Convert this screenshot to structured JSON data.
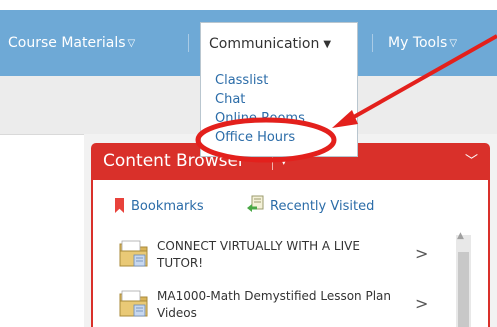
{
  "topnav": {
    "items": [
      {
        "label": "Course Materials",
        "caret": "▽"
      },
      {
        "label": "My Tools",
        "caret": "▽"
      }
    ],
    "active": {
      "label": "Communication",
      "caret": "▼"
    }
  },
  "dropdown": {
    "items": [
      "Classlist",
      "Chat",
      "Online Rooms",
      "Office Hours"
    ]
  },
  "content_browser": {
    "title": "Content Browser",
    "tools": {
      "bookmarks": "Bookmarks",
      "recently_visited": "Recently Visited"
    },
    "items": [
      {
        "title": "CONNECT VIRTUALLY WITH A LIVE TUTOR!"
      },
      {
        "title": "MA1000-Math Demystified Lesson Plan Videos"
      }
    ]
  },
  "colors": {
    "nav_bg": "#6ea9d6",
    "header_red": "#d9302a",
    "link_blue": "#2b6ca8",
    "annotation_red": "#e3201c"
  }
}
